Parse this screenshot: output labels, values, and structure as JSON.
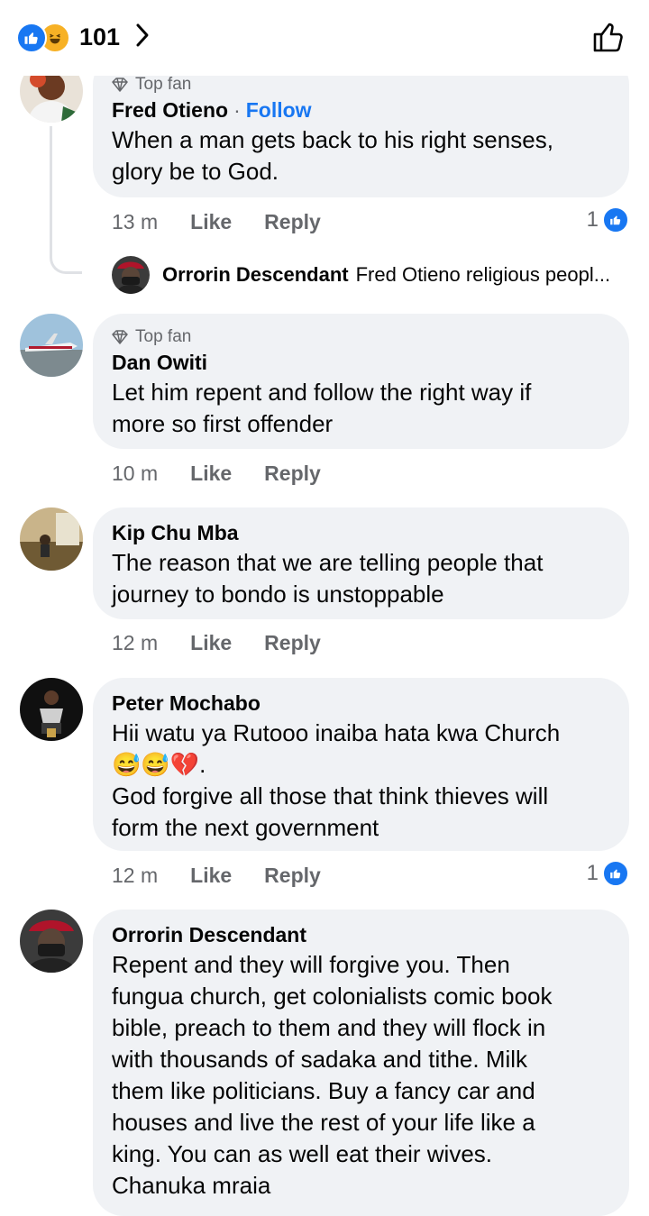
{
  "header": {
    "reaction_count": "101",
    "reaction_icons": [
      "like-icon",
      "haha-icon"
    ]
  },
  "comments": [
    {
      "badge": "Top fan",
      "name": "Fred Otieno",
      "follow": "Follow",
      "text": [
        "When a man gets back to his right senses,",
        "glory be to God."
      ],
      "time": "13 m",
      "like": "Like",
      "reply": "Reply",
      "likes": "1",
      "reply_preview": {
        "name": "Orrorin Descendant",
        "text": "Fred Otieno religious peopl..."
      }
    },
    {
      "badge": "Top fan",
      "name": "Dan Owiti",
      "text": [
        "Let him repent and follow the right way if",
        "more so first offender"
      ],
      "time": "10 m",
      "like": "Like",
      "reply": "Reply"
    },
    {
      "name": "Kip Chu Mba",
      "text": [
        "The reason that we are telling people that",
        "journey to bondo is unstoppable"
      ],
      "time": "12 m",
      "like": "Like",
      "reply": "Reply"
    },
    {
      "name": "Peter Mochabo",
      "text": [
        "Hii watu ya Rutooo inaiba hata kwa Church",
        "😅😅💔.",
        "God forgive all those that think thieves will",
        "form the next government"
      ],
      "time": "12 m",
      "like": "Like",
      "reply": "Reply",
      "likes": "1"
    },
    {
      "name": "Orrorin Descendant",
      "text": [
        "Repent and they will forgive you. Then",
        "fungua church, get colonialists comic book",
        "bible, preach to them and they will flock in",
        "with thousands of sadaka and tithe. Milk",
        "them like politicians. Buy a fancy car and",
        "houses and live the rest of your life like a",
        "king. You can as well eat their wives.",
        "Chanuka mraia"
      ]
    }
  ],
  "colors": {
    "accent": "#1877f2",
    "bubble": "#f0f2f5",
    "muted": "#65676b"
  }
}
